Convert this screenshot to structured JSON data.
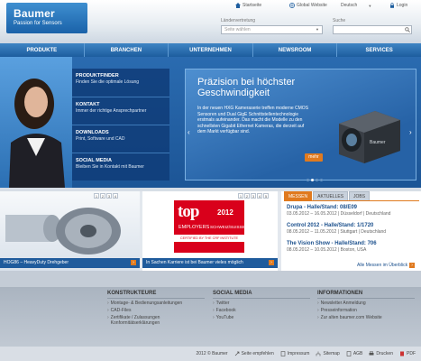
{
  "brand": {
    "name": "Baumer",
    "tagline": "Passion for Sensors"
  },
  "toplinks": {
    "home": "Startseite",
    "global": "Global Website",
    "language": "Deutsch",
    "login": "Login"
  },
  "country_select": {
    "label": "Ländervertretung",
    "placeholder": "Seite wählen"
  },
  "search": {
    "label": "Suche",
    "placeholder": ""
  },
  "nav": [
    "PRODUKTE",
    "BRANCHEN",
    "UNTERNEHMEN",
    "NEWSROOM",
    "SERVICES"
  ],
  "quicklinks": [
    {
      "title": "PRODUKTFINDER",
      "subtitle": "Finden Sie die optimale Lösung"
    },
    {
      "title": "KONTAKT",
      "subtitle": "Immer der richtige Ansprechpartner"
    },
    {
      "title": "DOWNLOADS",
      "subtitle": "Print, Software und CAD"
    },
    {
      "title": "SOCIAL MEDIA",
      "subtitle": "Bleiben Sie in Kontakt mit Baumer"
    }
  ],
  "promo": {
    "title": "Präzision bei höchster Geschwindigkeit",
    "text": "In der neuen HXG Kameraserie treffen moderne CMOS Sensoren und Dual GigE Schnittstellentechnologie erstmals aufeinander. Das macht die Modelle zu den schnellsten Gigabit Ethernet Kameras, die derzeit auf dem Markt verfügbar sind.",
    "button": "mehr"
  },
  "box1": {
    "caption": "HOG86 – HeavyDuty Drehgeber",
    "pager": [
      "1",
      "2",
      "3",
      "4"
    ]
  },
  "box2": {
    "badge_top": "top",
    "badge_year": "2012",
    "badge_sub": "EMPLOYERS",
    "badge_country": "SCHWEIZ/SUISSE",
    "badge_cert": "CERTIFIED BY THE CRF INSTITUTE",
    "caption": "In Sachen Karriere ist bei Baumer vieles möglich",
    "pager": [
      "1",
      "2",
      "3",
      "4",
      "5"
    ]
  },
  "events": {
    "tabs": [
      "MESSEN",
      "AKTUELLES",
      "JOBS"
    ],
    "items": [
      {
        "title": "Drupa - Halle/Stand: 08/E09",
        "detail": "03.05.2012 – 16.05.2012 | Düsseldorf | Deutschland"
      },
      {
        "title": "Control 2012 - Halle/Stand: 1/1720",
        "detail": "08.05.2012 – 11.05.2012 | Stuttgart | Deutschland"
      },
      {
        "title": "The Vision Show - Halle/Stand: 706",
        "detail": "08.05.2012 – 10.05.2012 | Boston, USA"
      }
    ],
    "all": "Alle Messen im Überblick"
  },
  "footer": {
    "cols": [
      {
        "title": "KONSTRUKTEURE",
        "links": [
          "Montage- & Bedienungsanleitungen",
          "CAD-Files",
          "Zertifikate / Zulassungen Konformitätserklärungen"
        ]
      },
      {
        "title": "SOCIAL MEDIA",
        "links": [
          "Twitter",
          "Facebook",
          "YouTube"
        ]
      },
      {
        "title": "INFORMATIONEN",
        "links": [
          "Newsletter Anmeldung",
          "Presseinformation",
          "Zur alten baumer.com Website"
        ]
      }
    ],
    "bottom": [
      "2012 © Baumer",
      "Seite empfehlen",
      "Impressum",
      "Sitemap",
      "AGB",
      "Drucken",
      "PDF"
    ]
  },
  "colors": {
    "brand_blue": "#1d5d9e",
    "accent_orange": "#e07a1f",
    "award_red": "#d9001b"
  }
}
